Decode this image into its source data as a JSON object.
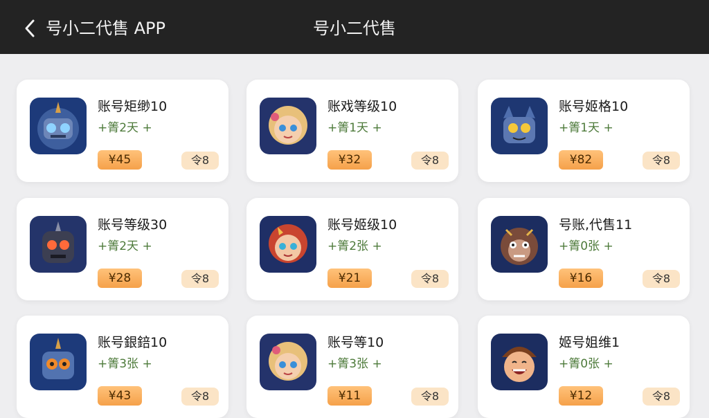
{
  "header": {
    "app_title": "号小二代售 APP",
    "center_title": "号小二代售"
  },
  "colors": {
    "header_bg": "#232323",
    "card_bg": "#ffffff",
    "price_bg": "#f5a14a",
    "tag_bg": "#fbe4c6",
    "subtitle_green": "#4d7a3a"
  },
  "cards": [
    {
      "title": "账号矩缈10",
      "subtitle": "+箐2天 +",
      "price": "¥45",
      "tag": "令8",
      "avatar": "robot-blue-icon"
    },
    {
      "title": "账戏等级10",
      "subtitle": "+箐1天 +",
      "price": "¥32",
      "tag": "令8",
      "avatar": "blonde-girl-icon"
    },
    {
      "title": "账号姬格10",
      "subtitle": "+箐1天 +",
      "price": "¥82",
      "tag": "令8",
      "avatar": "robot-yellow-eyes-icon"
    },
    {
      "title": "账号等级30",
      "subtitle": "+箐2天 +",
      "price": "¥28",
      "tag": "令8",
      "avatar": "robot-dark-icon"
    },
    {
      "title": "账号姬级10",
      "subtitle": "+箐2张 +",
      "price": "¥21",
      "tag": "令8",
      "avatar": "redhair-girl-icon"
    },
    {
      "title": "号账,代售11",
      "subtitle": "+箐0张 +",
      "price": "¥16",
      "tag": "令8",
      "avatar": "monkey-icon"
    },
    {
      "title": "账号銀錇10",
      "subtitle": "+箐3张 +",
      "price": "¥43",
      "tag": "令8",
      "avatar": "robot-orange-icon"
    },
    {
      "title": "账号等10",
      "subtitle": "+箐3张 +",
      "price": "¥11",
      "tag": "令8",
      "avatar": "blonde-girl-2-icon"
    },
    {
      "title": "姬号姐维1",
      "subtitle": "+箐0张 +",
      "price": "¥12",
      "tag": "令8",
      "avatar": "laughing-boy-icon"
    }
  ]
}
